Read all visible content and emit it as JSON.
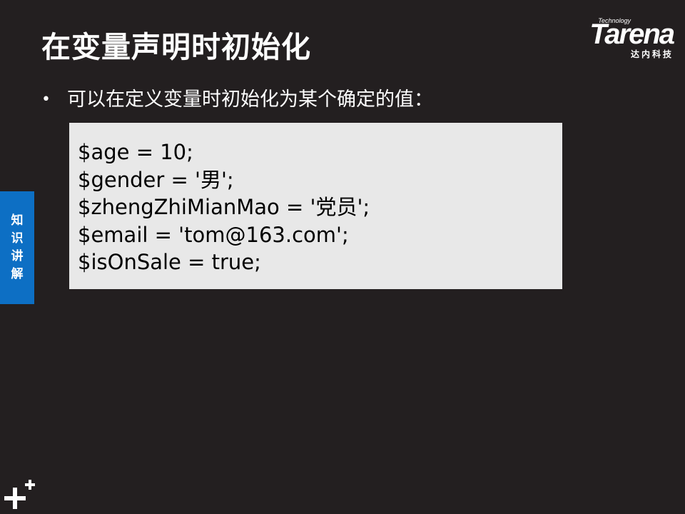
{
  "slide": {
    "title": "在变量声明时初始化",
    "bullet": "可以在定义变量时初始化为某个确定的值：",
    "bullet_marker": "•",
    "code_lines": [
      "$age = 10;",
      "$gender = '男';",
      "$zhengZhiMianMao = '党员';",
      "$email = 'tom@163.com';",
      "$isOnSale = true;"
    ]
  },
  "logo": {
    "tagline": "Technology",
    "wordmark": "Tarena",
    "chinese": "达内科技"
  },
  "side_tab": {
    "label": "知识讲解"
  },
  "icons": {
    "corner": "plus-cluster-icon"
  },
  "colors": {
    "background": "#231f20",
    "code_background": "#e8e8e8",
    "side_tab": "#0d6fc4",
    "text": "#ffffff",
    "code_text": "#000000"
  }
}
